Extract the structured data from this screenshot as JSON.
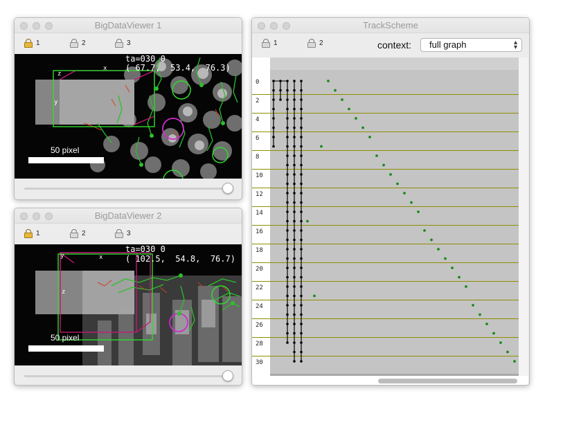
{
  "bdv1": {
    "title": "BigDataViewer 1",
    "sources": [
      {
        "label": "1",
        "locked": true
      },
      {
        "label": "2",
        "locked": false
      },
      {
        "label": "3",
        "locked": false
      }
    ],
    "overlay_line1": "ta=030 0",
    "overlay_line2": "( 67.7,  53.4,  76.3)",
    "scale_label": "50 pixel",
    "axis_x": "x",
    "axis_y": "y",
    "axis_z": "z",
    "timepoint_slider": 1.0
  },
  "bdv2": {
    "title": "BigDataViewer 2",
    "sources": [
      {
        "label": "1",
        "locked": true
      },
      {
        "label": "2",
        "locked": false
      },
      {
        "label": "3",
        "locked": false
      }
    ],
    "overlay_line1": "ta=030 0",
    "overlay_line2": "( 102.5,  54.8,  76.7)",
    "scale_label": "50 pixel",
    "axis_x": "x",
    "axis_y": "y",
    "axis_z": "z",
    "timepoint_slider": 1.0
  },
  "trackscheme": {
    "title": "TrackScheme",
    "sources": [
      {
        "label": "1",
        "locked": false
      },
      {
        "label": "2",
        "locked": false
      }
    ],
    "context_label": "context:",
    "context_value": "full graph",
    "row_labels": [
      "0",
      "2",
      "4",
      "6",
      "8",
      "10",
      "12",
      "14",
      "16",
      "18",
      "20",
      "22",
      "24",
      "26",
      "28",
      "30"
    ],
    "colors": {
      "background": "#c4c4c4",
      "row_line": "#8e8e00",
      "selected": "#000000",
      "unselected": "#1a8a1a"
    }
  }
}
